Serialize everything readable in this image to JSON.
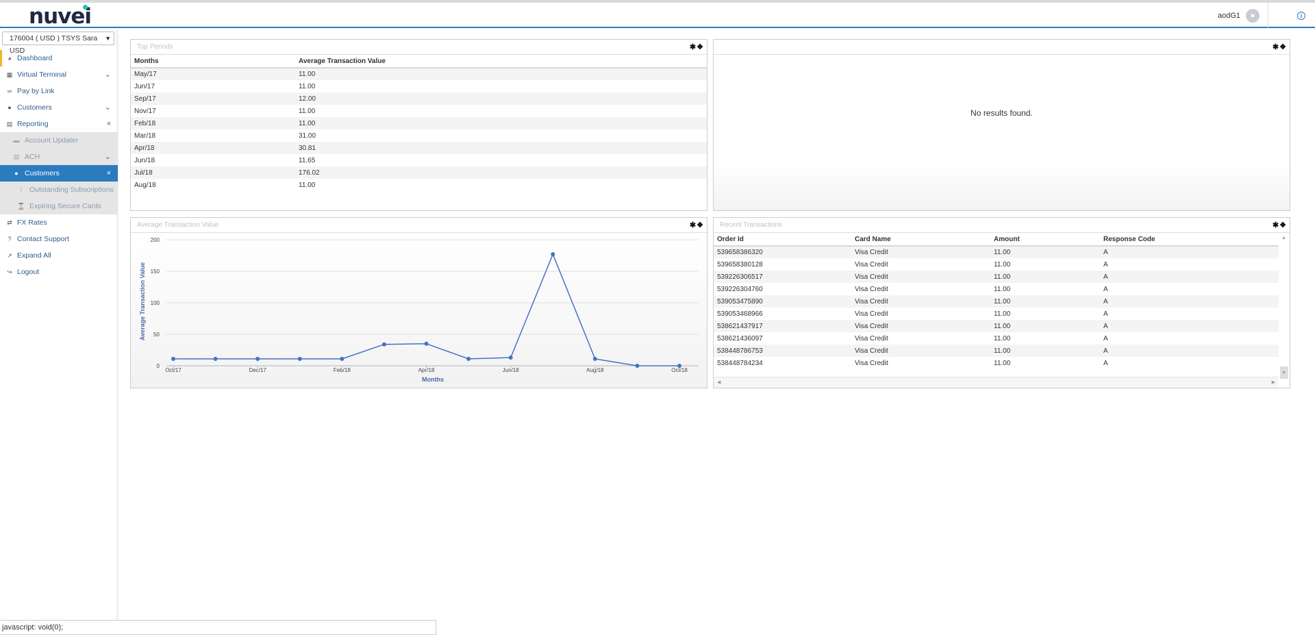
{
  "header": {
    "logo_text": "nuvei",
    "user_name": "aodG1"
  },
  "sidebar": {
    "merchant": "176004 ( USD ) TSYS Sara USD",
    "items": [
      {
        "label": "Dashboard"
      },
      {
        "label": "Virtual Terminal"
      },
      {
        "label": "Pay by Link"
      },
      {
        "label": "Customers"
      },
      {
        "label": "Reporting"
      },
      {
        "label": "Account Updater"
      },
      {
        "label": "ACH"
      },
      {
        "label": "Customers"
      },
      {
        "label": "Outstanding Subscriptions"
      },
      {
        "label": "Expiring Secure Cards"
      },
      {
        "label": "FX Rates"
      },
      {
        "label": "Contact Support"
      },
      {
        "label": "Expand All"
      },
      {
        "label": "Logout"
      }
    ]
  },
  "top_periods": {
    "title": "Top Periods",
    "columns": [
      "Months",
      "Average Transaction Value"
    ],
    "rows": [
      [
        "May/17",
        "11.00"
      ],
      [
        "Jun/17",
        "11.00"
      ],
      [
        "Sep/17",
        "12.00"
      ],
      [
        "Nov/17",
        "11.00"
      ],
      [
        "Feb/18",
        "11.00"
      ],
      [
        "Mar/18",
        "31.00"
      ],
      [
        "Apr/18",
        "30.81"
      ],
      [
        "Jun/18",
        "11.65"
      ],
      [
        "Jul/18",
        "176.02"
      ],
      [
        "Aug/18",
        "11.00"
      ]
    ]
  },
  "empty_panel": {
    "message": "No results found."
  },
  "avg_panel": {
    "title": "Average Transaction Value"
  },
  "chart_data": {
    "type": "line",
    "title": "",
    "xlabel": "Months",
    "ylabel": "Average Transaction Value",
    "ylim": [
      0,
      200
    ],
    "yticks": [
      0,
      50,
      100,
      150,
      200
    ],
    "grid": true,
    "tick_labels": [
      "Oct/17",
      "Dec/17",
      "Feb/18",
      "Apr/18",
      "Jun/18",
      "Aug/18",
      "Oct/18"
    ],
    "x": [
      "Oct/17",
      "Nov/17",
      "Dec/17",
      "Jan/18",
      "Feb/18",
      "Mar/18",
      "Apr/18",
      "May/18",
      "Jun/18",
      "Jul/18",
      "Aug/18",
      "Sep/18",
      "Oct/18"
    ],
    "values": [
      11,
      11,
      11,
      11,
      11,
      34,
      35,
      11,
      13,
      177,
      11,
      0,
      0
    ],
    "color": "#4472c4"
  },
  "recent": {
    "title": "Recent Transactions",
    "columns": [
      "Order Id",
      "Card Name",
      "Amount",
      "Response Code"
    ],
    "rows": [
      [
        "539658386320",
        "Visa Credit",
        "11.00",
        "A"
      ],
      [
        "539658380128",
        "Visa Credit",
        "11.00",
        "A"
      ],
      [
        "539226306517",
        "Visa Credit",
        "11.00",
        "A"
      ],
      [
        "539226304760",
        "Visa Credit",
        "11.00",
        "A"
      ],
      [
        "539053475890",
        "Visa Credit",
        "11.00",
        "A"
      ],
      [
        "539053468966",
        "Visa Credit",
        "11.00",
        "A"
      ],
      [
        "538621437917",
        "Visa Credit",
        "11.00",
        "A"
      ],
      [
        "538621436097",
        "Visa Credit",
        "11.00",
        "A"
      ],
      [
        "538448786753",
        "Visa Credit",
        "11.00",
        "A"
      ],
      [
        "538448784234",
        "Visa Credit",
        "11.00",
        "A"
      ]
    ]
  },
  "status": {
    "text": "javascript: void(0);"
  }
}
